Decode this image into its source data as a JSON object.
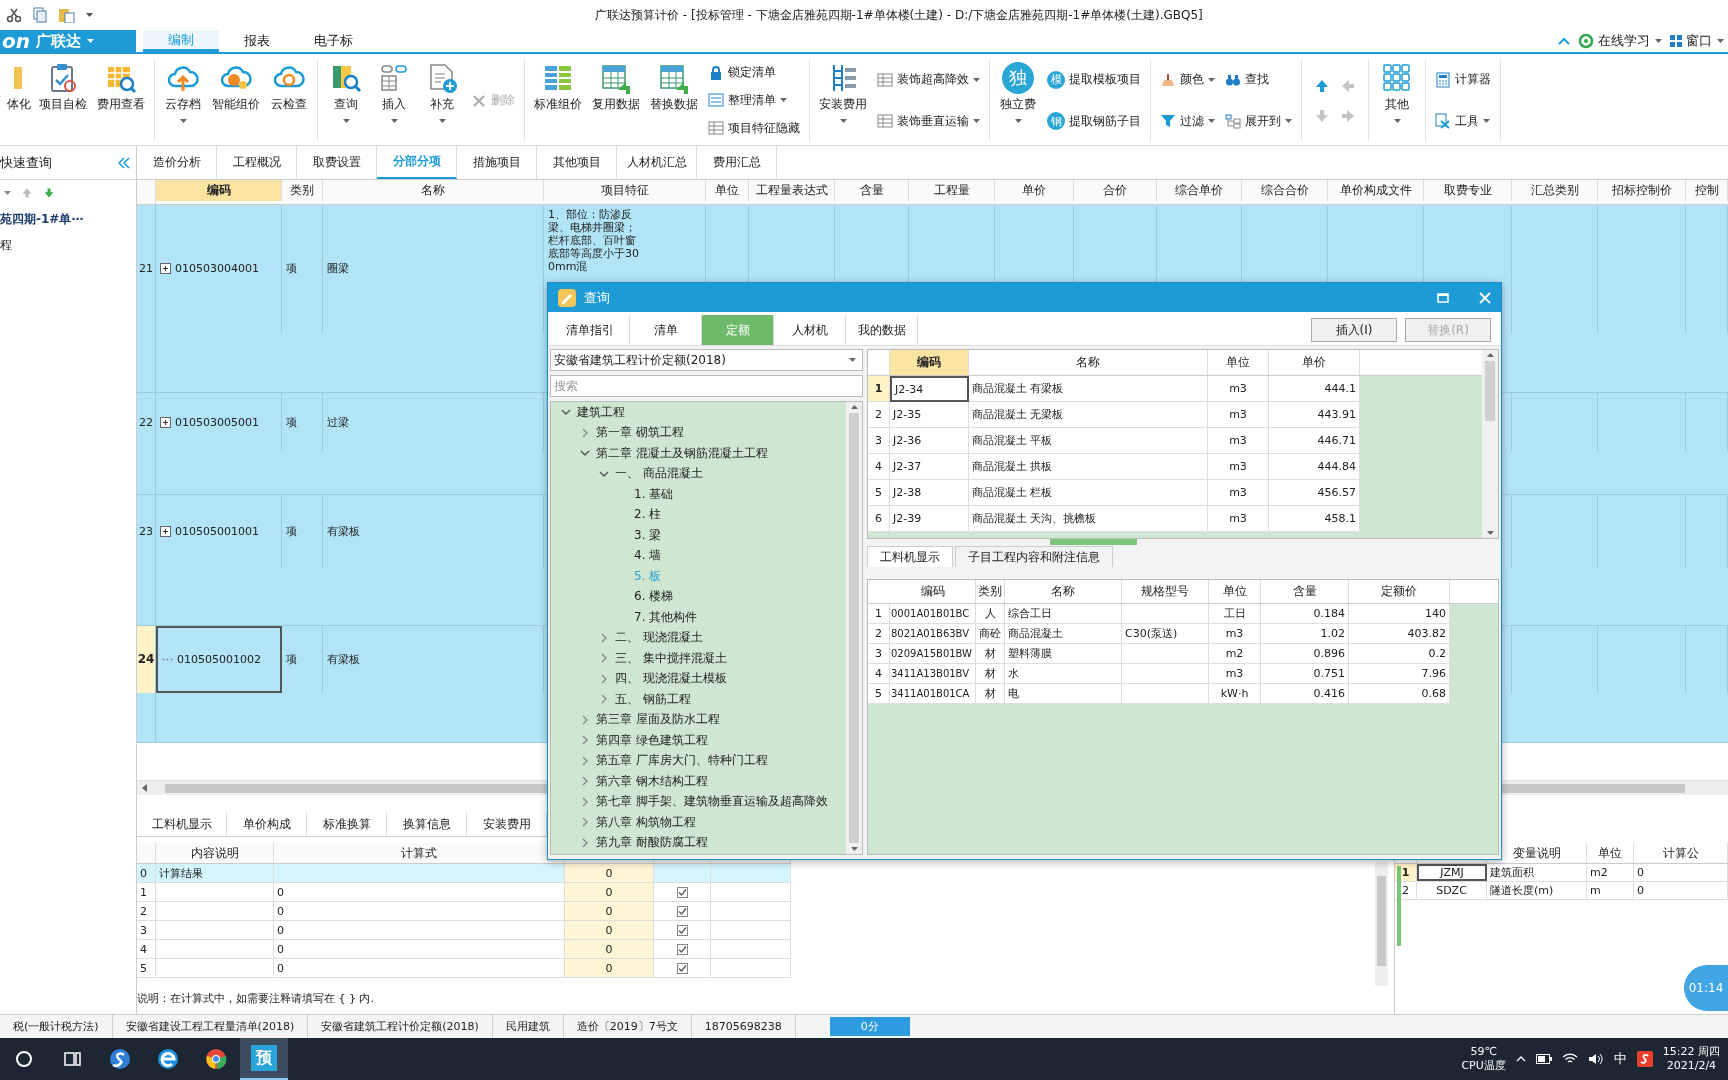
{
  "window": {
    "title": "广联达预算计价 - [投标管理 - 下塘金店雅苑四期-1#单体楼(土建) - D:/下塘金店雅苑四期-1#单体楼(土建).GBQ5]"
  },
  "brand": {
    "mark": "on",
    "name": "广联达"
  },
  "menu_tabs": [
    {
      "label": "编制",
      "selected": true
    },
    {
      "label": "报表",
      "selected": false
    },
    {
      "label": "电子标",
      "selected": false
    }
  ],
  "menu_right": [
    {
      "label": "在线学习",
      "dropdown": true
    },
    {
      "label": "窗口",
      "dropdown": true
    }
  ],
  "ribbon": {
    "groups": [
      {
        "items": [
          {
            "kind": "big",
            "label": "体化",
            "dropdown": false,
            "disabled": false
          },
          {
            "kind": "big",
            "label": "项目自检",
            "dropdown": false,
            "disabled": false
          },
          {
            "kind": "big",
            "label": "费用查看",
            "dropdown": false,
            "disabled": false
          }
        ]
      },
      {
        "items": [
          {
            "kind": "big",
            "label": "云存档",
            "dropdown": true,
            "disabled": false
          },
          {
            "kind": "big",
            "label": "智能组价",
            "dropdown": false,
            "disabled": false
          },
          {
            "kind": "big",
            "label": "云检查",
            "dropdown": false,
            "disabled": false
          }
        ]
      },
      {
        "items": [
          {
            "kind": "big",
            "label": "查询",
            "dropdown": true,
            "disabled": false
          },
          {
            "kind": "big",
            "label": "插入",
            "dropdown": true,
            "disabled": false
          },
          {
            "kind": "big",
            "label": "补充",
            "dropdown": true,
            "disabled": false
          },
          {
            "kind": "small",
            "label": "删除",
            "dropdown": false,
            "disabled": true
          }
        ]
      },
      {
        "items": [
          {
            "kind": "big",
            "label": "标准组价",
            "dropdown": false,
            "disabled": false
          },
          {
            "kind": "big",
            "label": "复用数据",
            "dropdown": false,
            "disabled": false
          },
          {
            "kind": "big",
            "label": "替换数据",
            "dropdown": false,
            "disabled": false
          },
          {
            "kind": "stack",
            "items": [
              {
                "label": "锁定清单",
                "dropdown": false,
                "disabled": false
              },
              {
                "label": "整理清单",
                "dropdown": true,
                "disabled": false
              },
              {
                "label": "项目特征隐藏",
                "dropdown": false,
                "disabled": false
              }
            ]
          }
        ]
      },
      {
        "items": [
          {
            "kind": "big",
            "label": "安装费用",
            "dropdown": true,
            "disabled": false
          },
          {
            "kind": "stack",
            "items": [
              {
                "label": "装饰超高降效",
                "dropdown": true,
                "disabled": false
              },
              {
                "label": "装饰垂直运输",
                "dropdown": true,
                "disabled": false
              }
            ]
          }
        ]
      },
      {
        "items": [
          {
            "kind": "badge",
            "label": "独立费",
            "glyph": "独",
            "dropdown": true,
            "disabled": false
          },
          {
            "kind": "stack",
            "items": [
              {
                "label": "提取模板项目",
                "glyph": "模",
                "dropdown": false,
                "disabled": false
              },
              {
                "label": "提取钢筋子目",
                "glyph": "钢",
                "dropdown": false,
                "disabled": false
              }
            ]
          }
        ]
      },
      {
        "items": [
          {
            "kind": "stack",
            "items": [
              {
                "label": "颜色",
                "dropdown": true,
                "disabled": false
              },
              {
                "label": "过滤",
                "dropdown": true,
                "disabled": false
              }
            ]
          },
          {
            "kind": "stack",
            "items": [
              {
                "label": "查找",
                "dropdown": false,
                "disabled": false
              },
              {
                "label": "展开到",
                "dropdown": true,
                "disabled": false
              }
            ]
          }
        ]
      },
      {
        "items": [
          {
            "kind": "arrows",
            "items": [
              {
                "disabled": false
              },
              {
                "disabled": true
              },
              {
                "disabled": true
              },
              {
                "disabled": true
              }
            ]
          }
        ]
      },
      {
        "items": [
          {
            "kind": "big",
            "label": "其他",
            "dropdown": true,
            "disabled": false
          }
        ]
      },
      {
        "items": [
          {
            "kind": "stack",
            "items": [
              {
                "label": "计算器",
                "dropdown": false,
                "disabled": false
              },
              {
                "label": "工具",
                "dropdown": true,
                "disabled": false
              }
            ]
          }
        ]
      }
    ]
  },
  "quick_search": {
    "title": "快速查询",
    "items": [
      {
        "label": "苑四期-1#单⋯",
        "kind": "project"
      },
      {
        "label": "程",
        "kind": "unit"
      }
    ]
  },
  "content_tabs": [
    {
      "label": "造价分析",
      "selected": false
    },
    {
      "label": "工程概况",
      "selected": false
    },
    {
      "label": "取费设置",
      "selected": false
    },
    {
      "label": "分部分项",
      "selected": true
    },
    {
      "label": "措施项目",
      "selected": false
    },
    {
      "label": "其他项目",
      "selected": false
    },
    {
      "label": "人材机汇总",
      "selected": false
    },
    {
      "label": "费用汇总",
      "selected": false
    }
  ],
  "main_table": {
    "columns": [
      {
        "label": "编码",
        "selected": true
      },
      {
        "label": "类别",
        "selected": false
      },
      {
        "label": "名称",
        "selected": false
      },
      {
        "label": "项目特征",
        "selected": false
      },
      {
        "label": "单位",
        "selected": false
      },
      {
        "label": "工程量表达式",
        "selected": false
      },
      {
        "label": "含量",
        "selected": false
      },
      {
        "label": "工程量",
        "selected": false
      },
      {
        "label": "单价",
        "selected": false
      },
      {
        "label": "合价",
        "selected": false
      },
      {
        "label": "综合单价",
        "selected": false
      },
      {
        "label": "综合合价",
        "selected": false
      },
      {
        "label": "单价构成文件",
        "selected": false
      },
      {
        "label": "取费专业",
        "selected": false
      },
      {
        "label": "汇总类别",
        "selected": false
      },
      {
        "label": "招标控制价",
        "selected": false
      },
      {
        "label": "控制",
        "selected": false
      }
    ],
    "rows": [
      {
        "index": "21",
        "expandable": true,
        "code": "010503004001",
        "type": "项",
        "name": "圈梁",
        "feature": "1、部位：防渗反梁、电梯井圈梁；栏杆底部、百叶窗底部等高度小于300mm混",
        "selected": false
      },
      {
        "index": "22",
        "expandable": true,
        "code": "010503005001",
        "type": "项",
        "name": "过梁",
        "selected": false
      },
      {
        "index": "23",
        "expandable": true,
        "code": "010505001001",
        "type": "项",
        "name": "有梁板",
        "selected": false
      },
      {
        "index": "24",
        "expandable": false,
        "code": "010505001002",
        "type": "项",
        "name": "有梁板",
        "selected": true
      }
    ]
  },
  "calc_panel": {
    "tabs": [
      "工料机显示",
      "单价构成",
      "标准换算",
      "换算信息",
      "安装费用"
    ],
    "columns": [
      "内容说明",
      "计算式"
    ],
    "rows": [
      {
        "kind": "result",
        "index": "0",
        "desc": "计算结果",
        "value": "0"
      },
      {
        "kind": "item",
        "index": "1",
        "formula": "0",
        "value": "0",
        "checked": true
      },
      {
        "kind": "item",
        "index": "2",
        "formula": "0",
        "value": "0",
        "checked": true
      },
      {
        "kind": "item",
        "index": "3",
        "formula": "0",
        "value": "0",
        "checked": true
      },
      {
        "kind": "item",
        "index": "4",
        "formula": "0",
        "value": "0",
        "checked": true
      },
      {
        "kind": "item",
        "index": "5",
        "formula": "0",
        "value": "0",
        "checked": true
      }
    ],
    "note": "说明：在计算式中，如需要注释请填写在 { } 内."
  },
  "var_panel": {
    "columns": [
      "变量说明",
      "单位",
      "计算公"
    ],
    "rows": [
      {
        "index": "1",
        "code": "JZMJ",
        "desc": "建筑面积",
        "unit": "m2",
        "value": "0",
        "selected": true
      },
      {
        "index": "2",
        "code": "SDZC",
        "desc": "隧道长度(m)",
        "unit": "m",
        "value": "0",
        "selected": false
      }
    ]
  },
  "query_dialog": {
    "title": "查询",
    "tabs": [
      {
        "label": "清单指引",
        "selected": false
      },
      {
        "label": "清单",
        "selected": false
      },
      {
        "label": "定额",
        "selected": true
      },
      {
        "label": "人材机",
        "selected": false
      },
      {
        "label": "我的数据",
        "selected": false
      }
    ],
    "buttons": [
      {
        "label": "插入(I)",
        "disabled": false
      },
      {
        "label": "替换(R)",
        "disabled": true
      }
    ],
    "library": "安徽省建筑工程计价定额(2018)",
    "search": {
      "placeholder": "搜索"
    },
    "tree": [
      {
        "label": "建筑工程",
        "expanded": true,
        "selected": false,
        "children": [
          {
            "label": "第一章  砌筑工程",
            "expanded": false,
            "selected": false
          },
          {
            "label": "第二章  混凝土及钢筋混凝土工程",
            "expanded": true,
            "selected": false,
            "children": [
              {
                "label": "一、  商品混凝土",
                "expanded": true,
                "selected": false,
                "children": [
                  {
                    "label": "1. 基础",
                    "selected": false
                  },
                  {
                    "label": "2. 柱",
                    "selected": false
                  },
                  {
                    "label": "3. 梁",
                    "selected": false
                  },
                  {
                    "label": "4. 墙",
                    "selected": false
                  },
                  {
                    "label": "5. 板",
                    "selected": true
                  },
                  {
                    "label": "6. 楼梯",
                    "selected": false
                  },
                  {
                    "label": "7. 其他构件",
                    "selected": false
                  }
                ]
              },
              {
                "label": "二、  现浇混凝土",
                "expanded": false,
                "selected": false
              },
              {
                "label": "三、  集中搅拌混凝土",
                "expanded": false,
                "selected": false
              },
              {
                "label": "四、  现浇混凝土模板",
                "expanded": false,
                "selected": false
              },
              {
                "label": "五、  钢筋工程",
                "expanded": false,
                "selected": false
              }
            ]
          },
          {
            "label": "第三章  屋面及防水工程",
            "expanded": false,
            "selected": false
          },
          {
            "label": "第四章  绿色建筑工程",
            "expanded": false,
            "selected": false
          },
          {
            "label": "第五章  厂库房大门、特种门工程",
            "expanded": false,
            "selected": false
          },
          {
            "label": "第六章  钢木结构工程",
            "expanded": false,
            "selected": false
          },
          {
            "label": "第七章  脚手架、建筑物垂直运输及超高降效",
            "expanded": false,
            "selected": false
          },
          {
            "label": "第八章  构筑物工程",
            "expanded": false,
            "selected": false
          },
          {
            "label": "第九章  耐酸防腐工程",
            "expanded": false,
            "selected": false
          }
        ]
      }
    ],
    "quota_table": {
      "columns": [
        {
          "label": "编码",
          "selected": true
        },
        {
          "label": "名称",
          "selected": false
        },
        {
          "label": "单位",
          "selected": false
        },
        {
          "label": "单价",
          "selected": false
        }
      ],
      "rows": [
        {
          "index": "1",
          "code": "J2-34",
          "name": "商品混凝土  有梁板",
          "unit": "m3",
          "price": "444.1",
          "selected": true
        },
        {
          "index": "2",
          "code": "J2-35",
          "name": "商品混凝土  无梁板",
          "unit": "m3",
          "price": "443.91",
          "selected": false
        },
        {
          "index": "3",
          "code": "J2-36",
          "name": "商品混凝土  平板",
          "unit": "m3",
          "price": "446.71",
          "selected": false
        },
        {
          "index": "4",
          "code": "J2-37",
          "name": "商品混凝土  拱板",
          "unit": "m3",
          "price": "444.84",
          "selected": false
        },
        {
          "index": "5",
          "code": "J2-38",
          "name": "商品混凝土  栏板",
          "unit": "m3",
          "price": "456.57",
          "selected": false
        },
        {
          "index": "6",
          "code": "J2-39",
          "name": "商品混凝土  天沟、挑檐板",
          "unit": "m3",
          "price": "458.1",
          "selected": false
        }
      ]
    },
    "detail_tabs": [
      {
        "label": "工料机显示",
        "selected": true
      },
      {
        "label": "子目工程内容和附注信息",
        "selected": false
      }
    ],
    "detail_table": {
      "columns": [
        "编码",
        "类别",
        "名称",
        "规格型号",
        "单位",
        "含量",
        "定额价"
      ],
      "rows": [
        {
          "index": "1",
          "code": "0001A01B01BC",
          "type": "人",
          "name": "综合工日",
          "spec": "",
          "unit": "工日",
          "amount": "0.184",
          "price": "140"
        },
        {
          "index": "2",
          "code": "8021A01B63BV",
          "type": "商砼",
          "name": "商品混凝土",
          "spec": "C30(泵送)",
          "unit": "m3",
          "amount": "1.02",
          "price": "403.82"
        },
        {
          "index": "3",
          "code": "0209A15B01BW",
          "type": "材",
          "name": "塑料薄膜",
          "spec": "",
          "unit": "m2",
          "amount": "0.896",
          "price": "0.2"
        },
        {
          "index": "4",
          "code": "3411A13B01BV",
          "type": "材",
          "name": "水",
          "spec": "",
          "unit": "m3",
          "amount": "0.751",
          "price": "7.96"
        },
        {
          "index": "5",
          "code": "3411A01B01CA",
          "type": "材",
          "name": "电",
          "spec": "",
          "unit": "kW·h",
          "amount": "0.416",
          "price": "0.68"
        }
      ]
    }
  },
  "timer": "01:14",
  "status_bar": {
    "items": [
      "税(一般计税方法)",
      "安徽省建设工程工程量清单(2018)",
      "安徽省建筑工程计价定额(2018)",
      "民用建筑",
      "造价〔2019〕7号文",
      "18705698238"
    ],
    "score": "0分"
  },
  "taskbar": {
    "apps": [
      {
        "kind": "search",
        "selected": false
      },
      {
        "kind": "tasks",
        "selected": false
      },
      {
        "kind": "sogou",
        "selected": false
      },
      {
        "kind": "ie",
        "selected": false
      },
      {
        "kind": "chrome",
        "selected": false
      },
      {
        "kind": "tile",
        "label": "预",
        "selected": true
      }
    ],
    "temperature": "59℃",
    "sensor": "CPU温度",
    "ime": "中",
    "time": "15:22 周四",
    "date": "2021/2/4"
  }
}
